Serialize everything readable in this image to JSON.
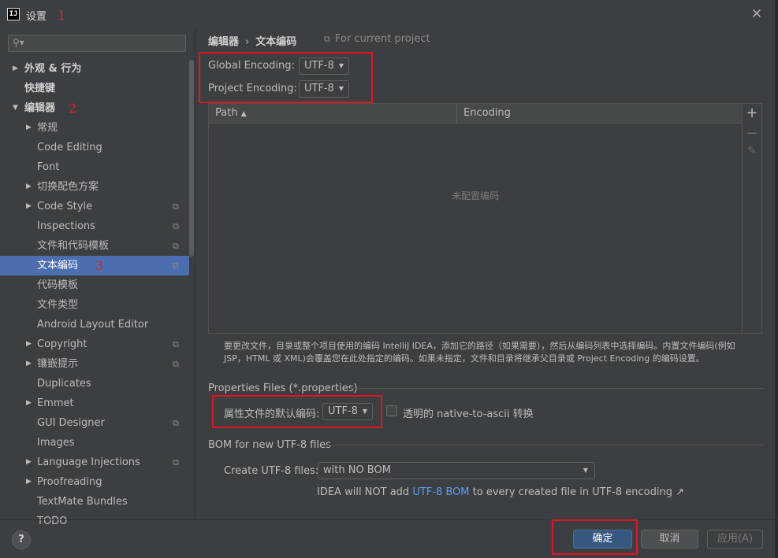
{
  "window": {
    "title": "设置",
    "close": "✕",
    "logo": "IJ"
  },
  "annotations": {
    "a1": "1",
    "a2": "2",
    "a3": "3"
  },
  "sidebar": {
    "search_placeholder": "",
    "items": [
      {
        "label": "外观 & 行为",
        "arrow": "▶",
        "indent": 0,
        "bold": true
      },
      {
        "label": "快捷键",
        "arrow": "",
        "indent": 0,
        "bold": true
      },
      {
        "label": "编辑器",
        "arrow": "▼",
        "indent": 0,
        "bold": true
      },
      {
        "label": "常规",
        "arrow": "▶",
        "indent": 1
      },
      {
        "label": "Code Editing",
        "arrow": "",
        "indent": 1
      },
      {
        "label": "Font",
        "arrow": "",
        "indent": 1
      },
      {
        "label": "切换配色方案",
        "arrow": "▶",
        "indent": 1
      },
      {
        "label": "Code Style",
        "arrow": "▶",
        "indent": 1,
        "project_icon": true
      },
      {
        "label": "Inspections",
        "arrow": "",
        "indent": 1,
        "project_icon": true
      },
      {
        "label": "文件和代码模板",
        "arrow": "",
        "indent": 1,
        "project_icon": true
      },
      {
        "label": "文本编码",
        "arrow": "",
        "indent": 1,
        "project_icon": true,
        "selected": true
      },
      {
        "label": "代码模板",
        "arrow": "",
        "indent": 1
      },
      {
        "label": "文件类型",
        "arrow": "",
        "indent": 1
      },
      {
        "label": "Android Layout Editor",
        "arrow": "",
        "indent": 1
      },
      {
        "label": "Copyright",
        "arrow": "▶",
        "indent": 1,
        "project_icon": true
      },
      {
        "label": "镶嵌提示",
        "arrow": "▶",
        "indent": 1,
        "project_icon": true
      },
      {
        "label": "Duplicates",
        "arrow": "",
        "indent": 1
      },
      {
        "label": "Emmet",
        "arrow": "▶",
        "indent": 1
      },
      {
        "label": "GUI Designer",
        "arrow": "",
        "indent": 1,
        "project_icon": true
      },
      {
        "label": "Images",
        "arrow": "",
        "indent": 1
      },
      {
        "label": "Language Injections",
        "arrow": "▶",
        "indent": 1,
        "project_icon": true
      },
      {
        "label": "Proofreading",
        "arrow": "▶",
        "indent": 1
      },
      {
        "label": "TextMate Bundles",
        "arrow": "",
        "indent": 1
      },
      {
        "label": "TODO",
        "arrow": "",
        "indent": 1
      }
    ]
  },
  "main": {
    "breadcrumb": {
      "parent": "编辑器",
      "separator": "›",
      "current": "文本编码"
    },
    "scope_label": "For current project",
    "global_encoding": {
      "label": "Global Encoding:",
      "value": "UTF-8"
    },
    "project_encoding": {
      "label": "Project Encoding:",
      "value": "UTF-8"
    },
    "table": {
      "columns": [
        {
          "label": "Path",
          "sort": "▲"
        },
        {
          "label": "Encoding"
        }
      ],
      "empty_text": "未配置编码",
      "tools": {
        "add": "+",
        "remove": "−",
        "edit": "✎"
      }
    },
    "description": "要更改文件，目录或整个项目使用的编码 IntelliJ IDEA，添加它的路径（如果需要），然后从编码列表中选择编码。内置文件编码(例如 JSP，HTML 或 XML)会覆盖您在此处指定的编码。如果未指定，文件和目录将继承父目录或 Project Encoding 的编码设置。",
    "properties_section": {
      "title": "Properties Files (*.properties)",
      "default_label": "属性文件的默认编码:",
      "default_value": "UTF-8",
      "ascii_label": "透明的 native-to-ascii 转换",
      "ascii_checked": false
    },
    "bom_section": {
      "title": "BOM for new UTF-8 files",
      "create_label": "Create UTF-8 files:",
      "create_value": "with NO BOM",
      "info_prefix": "IDEA will NOT add ",
      "info_link": "UTF-8 BOM",
      "info_suffix": " to every created file in UTF-8 encoding ↗"
    }
  },
  "footer": {
    "help": "?",
    "ok": "确定",
    "cancel": "取消",
    "apply": "应用(A)"
  },
  "colors": {
    "accent": "#4b6eaf",
    "primary_button": "#365880",
    "link": "#589df6",
    "highlight_box": "#e81123"
  }
}
